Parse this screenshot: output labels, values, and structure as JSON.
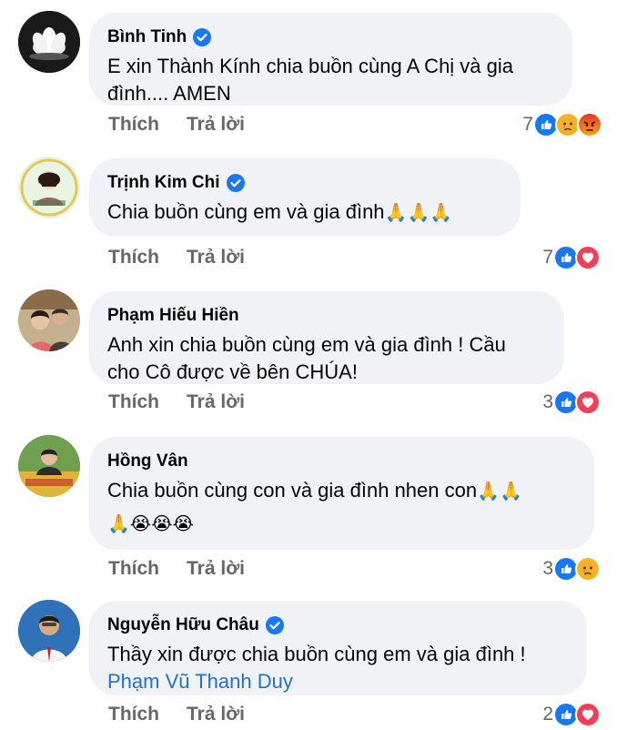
{
  "comments": [
    {
      "name": "Bình Tinh",
      "verified": true,
      "text_lines": [
        "E xin Thành Kính chia buồn cùng A Chị và gia",
        "đình.... AMEN"
      ],
      "actions": {
        "like": "Thích",
        "reply": "Trả lời"
      },
      "reaction_count": "7",
      "reactions": [
        "like-icon",
        "sad-icon",
        "angry-icon"
      ]
    },
    {
      "name": "Trịnh Kim Chi",
      "verified": true,
      "text": "Chia buồn cùng em và gia đình",
      "emoji": "🙏🙏🙏",
      "actions": {
        "like": "Thích",
        "reply": "Trả lời"
      },
      "reaction_count": "7",
      "reactions": [
        "like-icon",
        "love-icon"
      ]
    },
    {
      "name": "Phạm Hiếu Hiền",
      "verified": false,
      "text_lines": [
        "Anh xin chia buồn cùng em và gia đình ! Cầu",
        "cho Cô được về bên CHÚA!"
      ],
      "actions": {
        "like": "Thích",
        "reply": "Trả lời"
      },
      "reaction_count": "3",
      "reactions": [
        "like-icon",
        "love-icon"
      ]
    },
    {
      "name": "Hồng Vân",
      "verified": false,
      "text": "Chia buồn cùng con và gia đình nhen con",
      "emoji_line1": "🙏🙏",
      "emoji_line2": "🙏😭😭😭",
      "actions": {
        "like": "Thích",
        "reply": "Trả lời"
      },
      "reaction_count": "3",
      "reactions": [
        "like-icon",
        "sad-icon"
      ]
    },
    {
      "name": "Nguyễn Hữu Châu",
      "verified": true,
      "text": "Thầy xin được chia buồn cùng em và gia đình !",
      "mention": "Phạm Vũ Thanh Duy",
      "actions": {
        "like": "Thích",
        "reply": "Trả lời"
      },
      "reaction_count": "2",
      "reactions": [
        "like-icon",
        "love-icon"
      ]
    }
  ],
  "colors": {
    "bubble": "#f0f2f5",
    "meta": "#65676b",
    "verified": "#1877f2",
    "mention": "#216fdb",
    "like": "#1877f2",
    "love": "#f33e58",
    "sad": "#f7b125",
    "angry": "#e9710f"
  }
}
